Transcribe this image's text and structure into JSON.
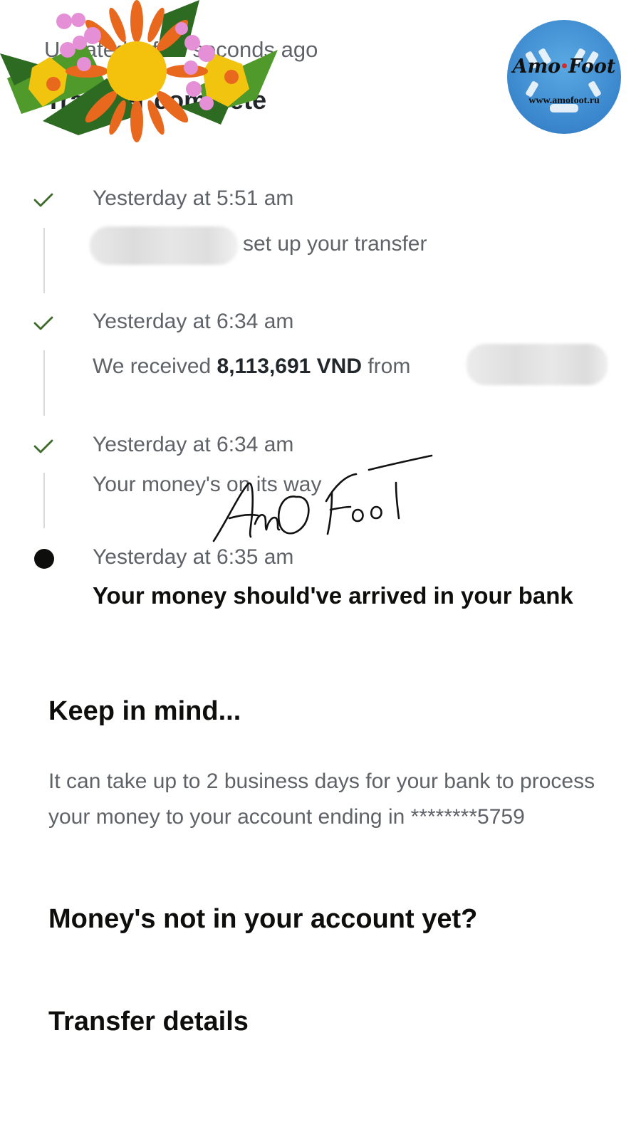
{
  "header": {
    "updated_text": "Updated a few seconds ago",
    "status_title": "Transfer complete"
  },
  "logo": {
    "name": "Amo Foot",
    "url": "www.amofoot.ru"
  },
  "timeline": [
    {
      "time": "Yesterday at 5:51 am",
      "desc": "set up your transfer",
      "state": "done"
    },
    {
      "time": "Yesterday at 6:34 am",
      "desc_prefix": "We received ",
      "amount": "8,113,691 VND",
      "desc_suffix": " from",
      "state": "done"
    },
    {
      "time": "Yesterday at 6:34 am",
      "desc": "Your money's on its way",
      "state": "done"
    },
    {
      "time": "Yesterday at 6:35 am",
      "desc": "Your money should've arrived in your bank",
      "state": "current"
    }
  ],
  "watermark": "AmO Foot",
  "keep_in_mind": {
    "heading": "Keep in mind...",
    "line1": "It can take up to 2 business days for your bank to process",
    "line2": "your money to your account ending in ********5759"
  },
  "sections": {
    "not_arrived": "Money's not in your account yet?",
    "details": "Transfer details"
  },
  "colors": {
    "check": "#3f6b2a",
    "dark": "#0e0f0c",
    "muted": "#5f6368"
  }
}
